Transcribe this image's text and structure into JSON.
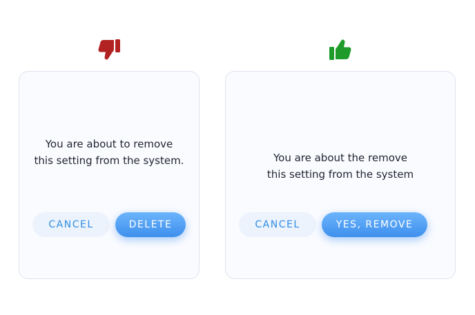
{
  "icons": {
    "bad": {
      "name": "thumbs-down-icon",
      "color": "#b22222"
    },
    "good": {
      "name": "thumbs-up-icon",
      "color": "#1e9b2a"
    }
  },
  "dialog_bad": {
    "message_line1": "You are about to remove",
    "message_line2": "this setting from the system.",
    "cancel_label": "CANCEL",
    "primary_label": "DELETE"
  },
  "dialog_good": {
    "message_line1": "You are about the remove",
    "message_line2": "this setting from the system",
    "cancel_label": "CANCEL",
    "primary_label": "YES, REMOVE"
  },
  "colors": {
    "accent": "#3e90ee",
    "cancel_text": "#2f8de4",
    "cancel_bg": "#ecf3fc",
    "dialog_bg": "#fafbff",
    "text": "#1f2430"
  }
}
